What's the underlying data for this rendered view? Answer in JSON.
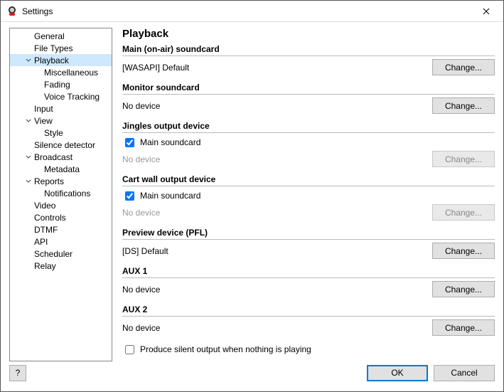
{
  "window": {
    "title": "Settings"
  },
  "tree": {
    "items": [
      {
        "label": "General",
        "indent": 1,
        "caret": false
      },
      {
        "label": "File Types",
        "indent": 1,
        "caret": false
      },
      {
        "label": "Playback",
        "indent": 1,
        "caret": true,
        "selected": true
      },
      {
        "label": "Miscellaneous",
        "indent": 2,
        "caret": false
      },
      {
        "label": "Fading",
        "indent": 2,
        "caret": false
      },
      {
        "label": "Voice Tracking",
        "indent": 2,
        "caret": false
      },
      {
        "label": "Input",
        "indent": 1,
        "caret": false
      },
      {
        "label": "View",
        "indent": 1,
        "caret": true
      },
      {
        "label": "Style",
        "indent": 2,
        "caret": false
      },
      {
        "label": "Silence detector",
        "indent": 1,
        "caret": false
      },
      {
        "label": "Broadcast",
        "indent": 1,
        "caret": true
      },
      {
        "label": "Metadata",
        "indent": 2,
        "caret": false
      },
      {
        "label": "Reports",
        "indent": 1,
        "caret": true
      },
      {
        "label": "Notifications",
        "indent": 2,
        "caret": false
      },
      {
        "label": "Video",
        "indent": 1,
        "caret": false
      },
      {
        "label": "Controls",
        "indent": 1,
        "caret": false
      },
      {
        "label": "DTMF",
        "indent": 1,
        "caret": false
      },
      {
        "label": "API",
        "indent": 1,
        "caret": false
      },
      {
        "label": "Scheduler",
        "indent": 1,
        "caret": false
      },
      {
        "label": "Relay",
        "indent": 1,
        "caret": false
      }
    ]
  },
  "page": {
    "title": "Playback",
    "change_label": "Change...",
    "sections": {
      "main_soundcard": {
        "title": "Main (on-air) soundcard",
        "value": "[WASAPI] Default",
        "checkbox": null,
        "checked": false,
        "disabled": false
      },
      "monitor_soundcard": {
        "title": "Monitor soundcard",
        "value": "No device",
        "checkbox": null,
        "checked": false,
        "disabled": false
      },
      "jingles_output": {
        "title": "Jingles output device",
        "value": "No device",
        "checkbox": "Main soundcard",
        "checked": true,
        "disabled": true
      },
      "cartwall_output": {
        "title": "Cart wall output device",
        "value": "No device",
        "checkbox": "Main soundcard",
        "checked": true,
        "disabled": true
      },
      "preview_device": {
        "title": "Preview device (PFL)",
        "value": "[DS] Default",
        "checkbox": null,
        "checked": false,
        "disabled": false
      },
      "aux1": {
        "title": "AUX 1",
        "value": "No device",
        "checkbox": null,
        "checked": false,
        "disabled": false
      },
      "aux2": {
        "title": "AUX 2",
        "value": "No device",
        "checkbox": null,
        "checked": false,
        "disabled": false
      }
    },
    "silent_output": {
      "label": "Produce silent output when nothing is playing",
      "checked": false
    }
  },
  "footer": {
    "help": "?",
    "ok": "OK",
    "cancel": "Cancel"
  }
}
